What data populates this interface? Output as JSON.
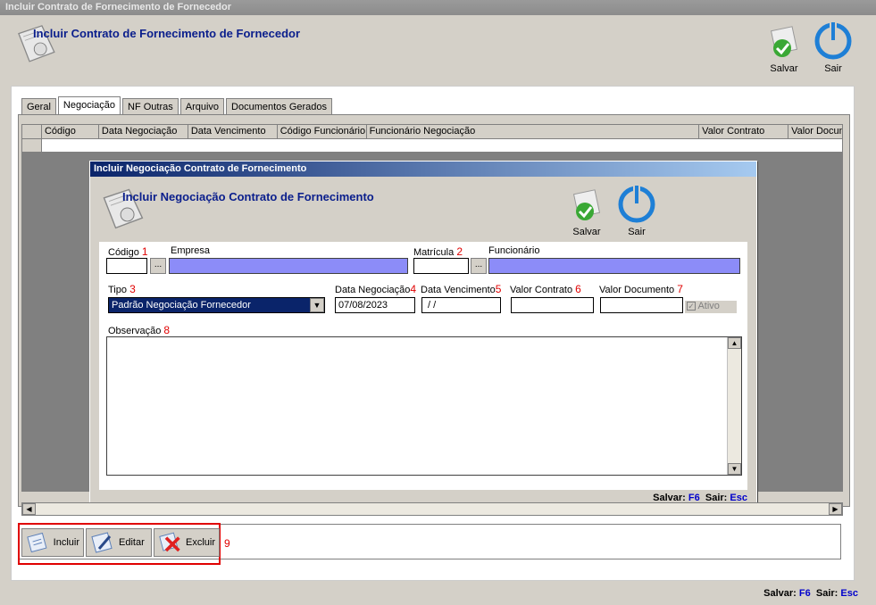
{
  "window": {
    "title": "Incluir Contrato de Fornecimento de Fornecedor"
  },
  "header": {
    "title": "Incluir Contrato de Fornecimento de Fornecedor",
    "save_label": "Salvar",
    "exit_label": "Sair"
  },
  "tabs": [
    {
      "label": "Geral"
    },
    {
      "label": "Negociação"
    },
    {
      "label": "NF Outras"
    },
    {
      "label": "Arquivo"
    },
    {
      "label": "Documentos Gerados"
    }
  ],
  "grid": {
    "columns": [
      "",
      "Código",
      "Data Negociação",
      "Data Vencimento",
      "Código Funcionário",
      "Funcionário Negociação",
      "Valor Contrato",
      "Valor Docum"
    ]
  },
  "dialog": {
    "title": "Incluir  Negociação Contrato de Fornecimento",
    "heading": "Incluir Negociação Contrato de Fornecimento",
    "save_label": "Salvar",
    "exit_label": "Sair",
    "fields": {
      "codigo_label": "Código",
      "codigo_num": "1",
      "codigo_value": "",
      "empresa_label": "Empresa",
      "matricula_label": "Matrícula",
      "matricula_num": "2",
      "matricula_value": "",
      "funcionario_label": "Funcionário",
      "tipo_label": "Tipo",
      "tipo_num": "3",
      "tipo_value": "Padrão Negociação Fornecedor",
      "data_neg_label": "Data Negociação",
      "data_neg_num": "4",
      "data_neg_value": "07/08/2023",
      "data_venc_label": "Data Vencimento",
      "data_venc_num": "5",
      "data_venc_value": " / /",
      "valor_contrato_label": "Valor Contrato",
      "valor_contrato_num": "6",
      "valor_contrato_value": "",
      "valor_doc_label": "Valor Documento",
      "valor_doc_num": "7",
      "valor_doc_value": "",
      "ativo_label": "Ativo",
      "obs_label": "Observação",
      "obs_num": "8",
      "obs_value": ""
    },
    "hotkeys": {
      "save_label": "Salvar:",
      "save_key": "F6",
      "exit_label": "Sair:",
      "exit_key": "Esc"
    }
  },
  "bottom_toolbar": {
    "incluir_label": "Incluir",
    "editar_label": "Editar",
    "excluir_label": "Excluir",
    "num": "9"
  },
  "footer_hotkeys": {
    "save_label": "Salvar:",
    "save_key": "F6",
    "exit_label": "Sair:",
    "exit_key": "Esc"
  }
}
